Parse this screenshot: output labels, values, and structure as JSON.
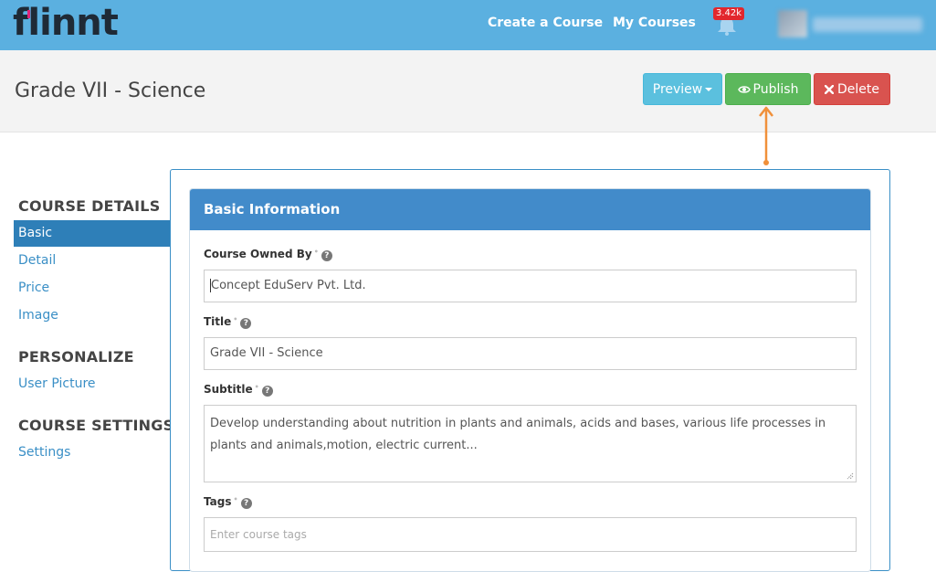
{
  "topbar": {
    "logo": "flinnt",
    "nav": {
      "create_course": "Create a Course",
      "my_courses": "My Courses"
    },
    "notifications_badge": "3.42k",
    "colors": {
      "bar": "#5bb0e0",
      "badge": "#e2272d"
    }
  },
  "header": {
    "title": "Grade VII - Science",
    "buttons": {
      "preview": "Preview",
      "publish": "Publish",
      "delete": "Delete"
    }
  },
  "sidebar": {
    "sections": [
      {
        "heading": "COURSE DETAILS",
        "items": [
          "Basic",
          "Detail",
          "Price",
          "Image"
        ]
      },
      {
        "heading": "PERSONALIZE",
        "items": [
          "User Picture"
        ]
      },
      {
        "heading": "COURSE SETTINGS",
        "items": [
          "Settings"
        ]
      }
    ],
    "active_item": "Basic"
  },
  "panel": {
    "title": "Basic Information",
    "fields": {
      "owner": {
        "label": "Course Owned By",
        "value": "Concept EduServ Pvt. Ltd."
      },
      "title": {
        "label": "Title",
        "value": "Grade VII - Science"
      },
      "subtitle": {
        "label": "Subtitle",
        "value": "Develop understanding about nutrition in plants and animals, acids and bases, various life processes in plants and animals,motion, electric current..."
      },
      "tags": {
        "label": "Tags",
        "placeholder": "Enter course tags"
      }
    }
  }
}
